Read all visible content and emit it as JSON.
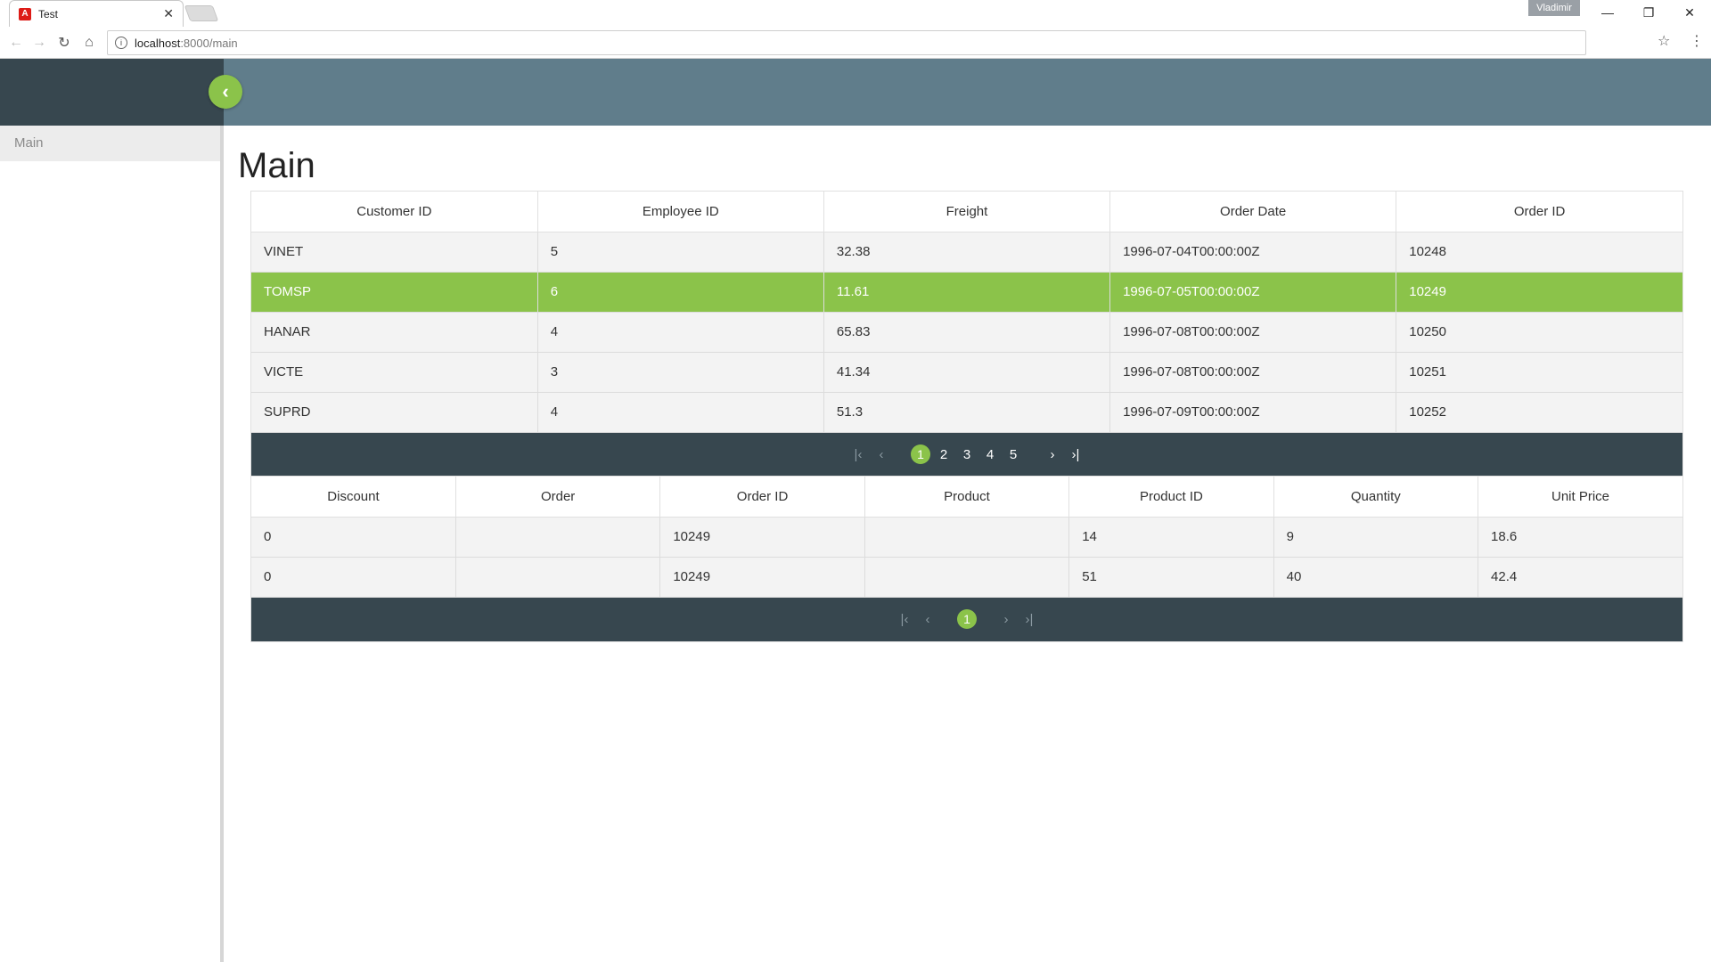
{
  "browser": {
    "tab_title": "Test",
    "tab_close": "✕",
    "user": "Vladimir",
    "url_host": "localhost",
    "url_path": ":8000/main",
    "controls": {
      "minimize": "—",
      "restore": "❐",
      "close": "✕"
    },
    "nav": {
      "back": "←",
      "forward": "→",
      "reload": "↻",
      "home": "⌂",
      "star": "☆",
      "menu": "⋮"
    }
  },
  "app": {
    "toggle_icon": "‹",
    "sidebar": {
      "items": [
        {
          "label": "Main"
        }
      ]
    },
    "page_title": "Main"
  },
  "orders": {
    "columns": [
      "Customer ID",
      "Employee ID",
      "Freight",
      "Order Date",
      "Order ID"
    ],
    "rows": [
      [
        "VINET",
        "5",
        "32.38",
        "1996-07-04T00:00:00Z",
        "10248"
      ],
      [
        "TOMSP",
        "6",
        "11.61",
        "1996-07-05T00:00:00Z",
        "10249"
      ],
      [
        "HANAR",
        "4",
        "65.83",
        "1996-07-08T00:00:00Z",
        "10250"
      ],
      [
        "VICTE",
        "3",
        "41.34",
        "1996-07-08T00:00:00Z",
        "10251"
      ],
      [
        "SUPRD",
        "4",
        "51.3",
        "1996-07-09T00:00:00Z",
        "10252"
      ]
    ],
    "selected_row": 1,
    "pager": {
      "first": "|‹",
      "prev": "‹",
      "pages": [
        "1",
        "2",
        "3",
        "4",
        "5"
      ],
      "current": "1",
      "next": "›",
      "last": "›|"
    }
  },
  "details": {
    "columns": [
      "Discount",
      "Order",
      "Order ID",
      "Product",
      "Product ID",
      "Quantity",
      "Unit Price"
    ],
    "rows": [
      [
        "0",
        "",
        "10249",
        "",
        "14",
        "9",
        "18.6"
      ],
      [
        "0",
        "",
        "10249",
        "",
        "51",
        "40",
        "42.4"
      ]
    ],
    "pager": {
      "first": "|‹",
      "prev": "‹",
      "pages": [
        "1"
      ],
      "current": "1",
      "next": "›",
      "last": "›|"
    }
  },
  "colors": {
    "header": "#607d8b",
    "sidebar_header": "#37474f",
    "accent": "#8bc34a",
    "pager": "#37474f"
  }
}
